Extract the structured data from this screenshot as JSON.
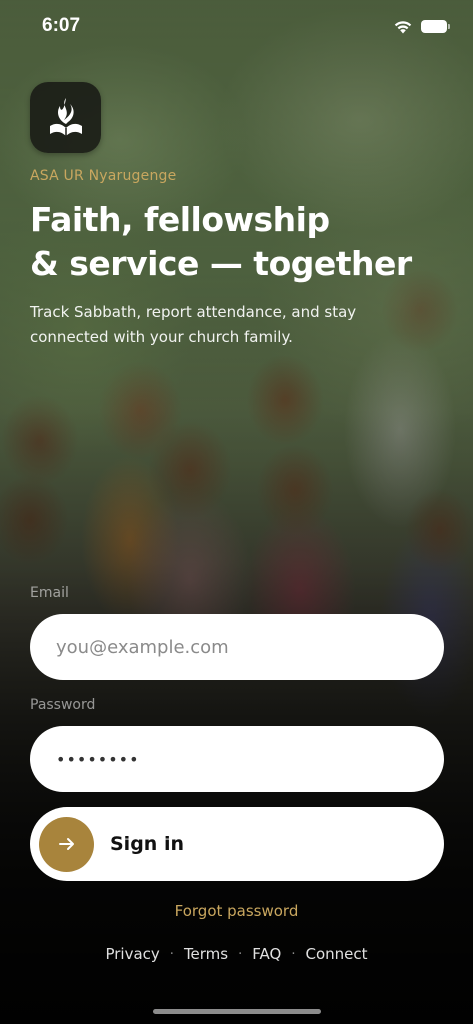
{
  "status_bar": {
    "time": "6:07"
  },
  "brand": {
    "org_name": "ASA UR Nyarugenge",
    "logo_icon": "sda-flame-book-icon",
    "accent_color": "#c9a75f",
    "button_accent": "#a8843c"
  },
  "hero": {
    "headline_line1": "Faith, fellowship",
    "headline_line2": "& service — together",
    "subtext": "Track Sabbath, report attendance, and stay connected with your church family."
  },
  "form": {
    "email_label": "Email",
    "email_placeholder": "you@example.com",
    "email_value": "",
    "password_label": "Password",
    "password_value": "••••••••",
    "signin_label": "Sign in",
    "signin_icon": "arrow-right-icon",
    "forgot_label": "Forgot password"
  },
  "footer": {
    "links": [
      "Privacy",
      "Terms",
      "FAQ",
      "Connect"
    ],
    "separator": "·"
  }
}
